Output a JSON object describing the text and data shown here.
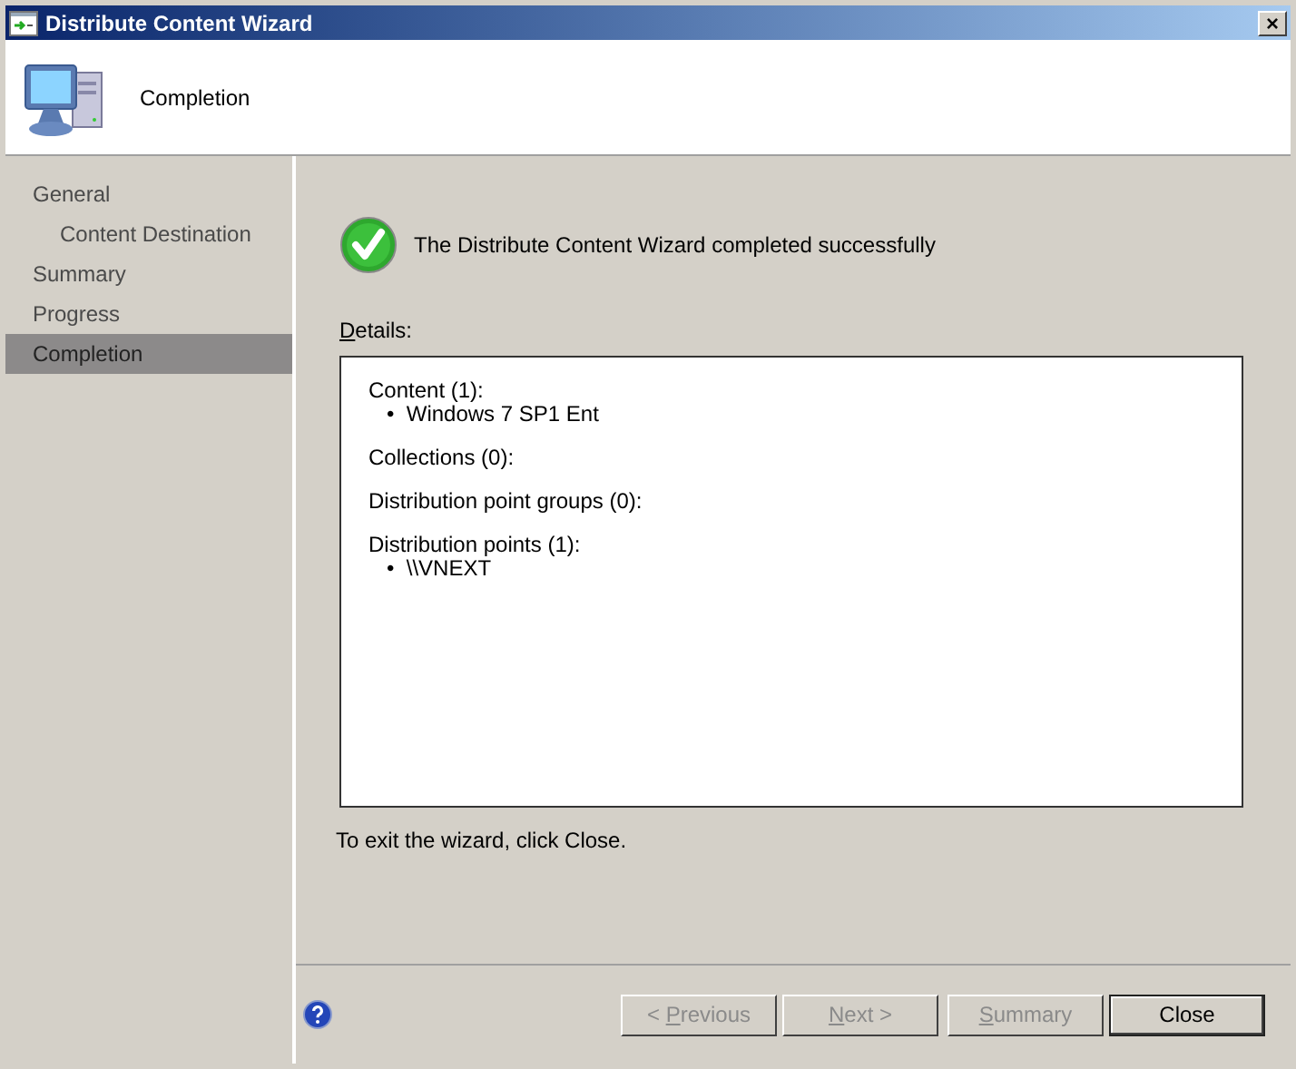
{
  "window": {
    "title": "Distribute Content Wizard",
    "close": "×"
  },
  "header": {
    "title": "Completion"
  },
  "sidebar": {
    "items": [
      {
        "label": "General",
        "selected": false,
        "children": [
          {
            "label": "Content Destination",
            "selected": false
          }
        ]
      },
      {
        "label": "Summary",
        "selected": false
      },
      {
        "label": "Progress",
        "selected": false
      },
      {
        "label": "Completion",
        "selected": true
      }
    ]
  },
  "status": {
    "message": "The Distribute Content Wizard completed successfully"
  },
  "details": {
    "label": {
      "key": "D",
      "after": "etails:"
    },
    "sections": [
      {
        "heading": "Content (1):",
        "items": [
          "•  Windows 7 SP1 Ent"
        ]
      },
      {
        "heading": "Collections (0):"
      },
      {
        "heading": "Distribution point groups (0):"
      },
      {
        "heading": "Distribution points (1):",
        "items": [
          "•  \\\\VNEXT"
        ]
      }
    ]
  },
  "hint": "To exit the wizard, click Close.",
  "buttons": [
    {
      "before": "< ",
      "key": "P",
      "after": "revious",
      "disabled": true,
      "default": false
    },
    {
      "key": "N",
      "after": "ext >",
      "disabled": true,
      "default": false
    },
    {
      "key": "S",
      "after": "ummary",
      "disabled": true,
      "default": false
    },
    {
      "after": "Close",
      "disabled": false,
      "default": true
    }
  ]
}
